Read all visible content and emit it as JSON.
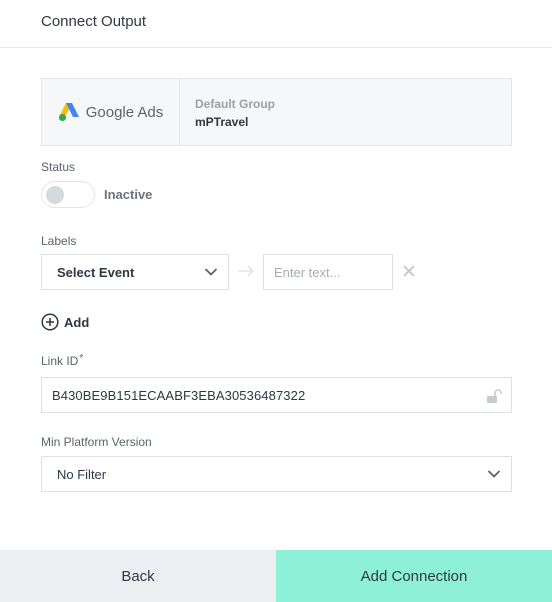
{
  "header": {
    "title": "Connect Output"
  },
  "destination": {
    "logo_text": "Google Ads",
    "logo_icon": "google-ads-logo",
    "group": "Default Group",
    "name": "mPTravel"
  },
  "status": {
    "label": "Status",
    "toggle_state": "off",
    "value_text": "Inactive"
  },
  "labels": {
    "label": "Labels",
    "event_select_value": "Select Event",
    "text_placeholder": "Enter text...",
    "add_label": "Add"
  },
  "link_id": {
    "label": "Link ID",
    "required_marker": "*",
    "value": "B430BE9B151ECAABF3EBA30536487322"
  },
  "min_platform_version": {
    "label": "Min Platform Version",
    "value": "No Filter"
  },
  "footer": {
    "back_label": "Back",
    "add_connection_label": "Add Connection"
  },
  "colors": {
    "primary_button": "#8ef0d6",
    "secondary_button": "#eceef1",
    "required": "#e0243c"
  }
}
